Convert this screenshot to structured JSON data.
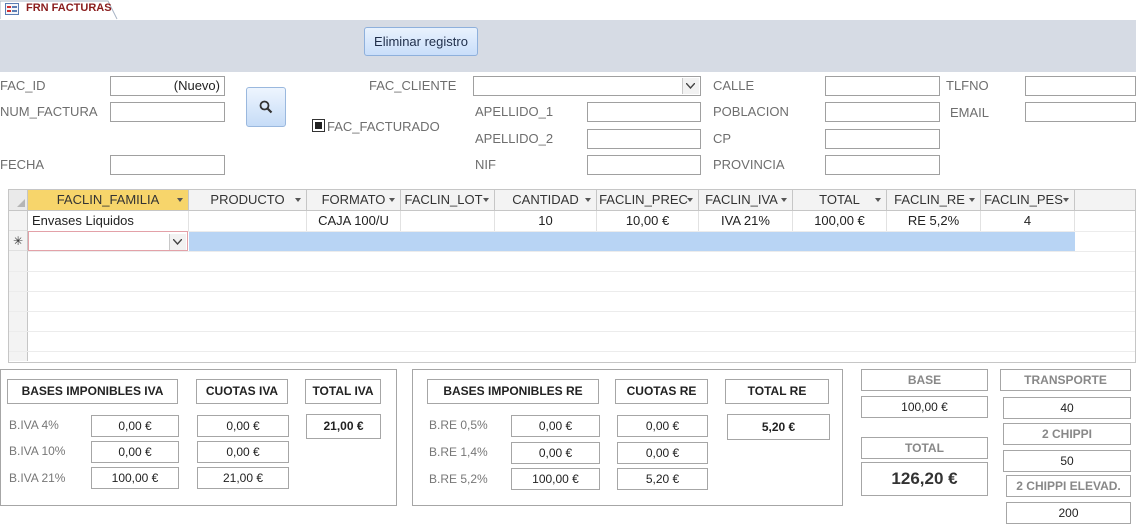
{
  "tab": {
    "title": "FRN FACTURAS",
    "icon": "form-icon"
  },
  "header": {
    "delete_button": "Eliminar registro"
  },
  "form": {
    "fac_id": {
      "label": "FAC_ID",
      "value": "(Nuevo)"
    },
    "num_factura": {
      "label": "NUM_FACTURA",
      "value": ""
    },
    "fecha": {
      "label": "FECHA",
      "value": ""
    },
    "search_icon": "magnifier-icon",
    "fac_facturado": {
      "label": "FAC_FACTURADO",
      "checked": true
    },
    "fac_cliente": {
      "label": "FAC_CLIENTE",
      "value": ""
    },
    "apellido_1": {
      "label": "APELLIDO_1",
      "value": ""
    },
    "apellido_2": {
      "label": "APELLIDO_2",
      "value": ""
    },
    "nif": {
      "label": "NIF",
      "value": ""
    },
    "calle": {
      "label": "CALLE",
      "value": ""
    },
    "poblacion": {
      "label": "POBLACION",
      "value": ""
    },
    "cp": {
      "label": "CP",
      "value": ""
    },
    "provincia": {
      "label": "PROVINCIA",
      "value": ""
    },
    "tlfno": {
      "label": "TLFNO",
      "value": ""
    },
    "email": {
      "label": "EMAIL",
      "value": ""
    }
  },
  "grid": {
    "columns": [
      "FACLIN_FAMILIA",
      "PRODUCTO",
      "FORMATO",
      "FACLIN_LOT",
      "CANTIDAD",
      "FACLIN_PREC",
      "FACLIN_IVA",
      "TOTAL",
      "FACLIN_RE",
      "FACLIN_PES"
    ],
    "rows": [
      [
        "Envases Liquidos",
        "",
        "CAJA 100/U",
        "",
        "10",
        "10,00 €",
        "IVA 21%",
        "100,00 €",
        "RE 5,2%",
        "4"
      ]
    ],
    "new_row_marker": "✳"
  },
  "iva": {
    "bases_header": "BASES IMPONIBLES IVA",
    "cuotas_header": "CUOTAS IVA",
    "total_header": "TOTAL IVA",
    "rows": [
      {
        "label": "B.IVA 4%",
        "base": "0,00 €",
        "cuota": "0,00 €"
      },
      {
        "label": "B.IVA 10%",
        "base": "0,00 €",
        "cuota": "0,00 €"
      },
      {
        "label": "B.IVA 21%",
        "base": "100,00 €",
        "cuota": "21,00 €"
      }
    ],
    "total": "21,00 €"
  },
  "re": {
    "bases_header": "BASES IMPONIBLES RE",
    "cuotas_header": "CUOTAS RE",
    "total_header": "TOTAL RE",
    "rows": [
      {
        "label": "B.RE 0,5%",
        "base": "0,00 €",
        "cuota": "0,00 €"
      },
      {
        "label": "B.RE 1,4%",
        "base": "0,00 €",
        "cuota": "0,00 €"
      },
      {
        "label": "B.RE 5,2%",
        "base": "100,00 €",
        "cuota": "5,20 €"
      }
    ],
    "total": "5,20 €"
  },
  "summary": {
    "base_label": "BASE",
    "base_value": "100,00 €",
    "total_label": "TOTAL",
    "total_value": "126,20 €",
    "transporte_label": "TRANSPORTE",
    "transporte_value": "40",
    "chippi_label": "2 CHIPPI",
    "chippi_value": "50",
    "chippi_elev_label": "2 CHIPPI ELEVAD.",
    "chippi_elev_value": "200"
  }
}
